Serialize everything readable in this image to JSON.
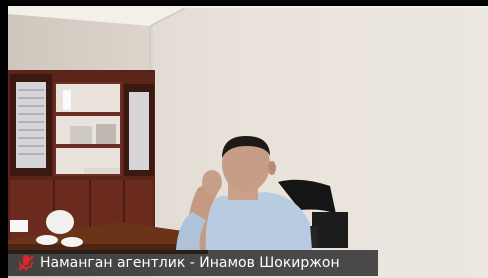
{
  "participant": {
    "display_name": "Наманган агентлик - Инамов Шокиржон",
    "mic_icon": "microphone-muted-icon",
    "mic_color": "#e0262a"
  },
  "colors": {
    "wall": "#e6dfd7",
    "cabinet": "#5a2519",
    "shirt": "#b9cde2"
  }
}
